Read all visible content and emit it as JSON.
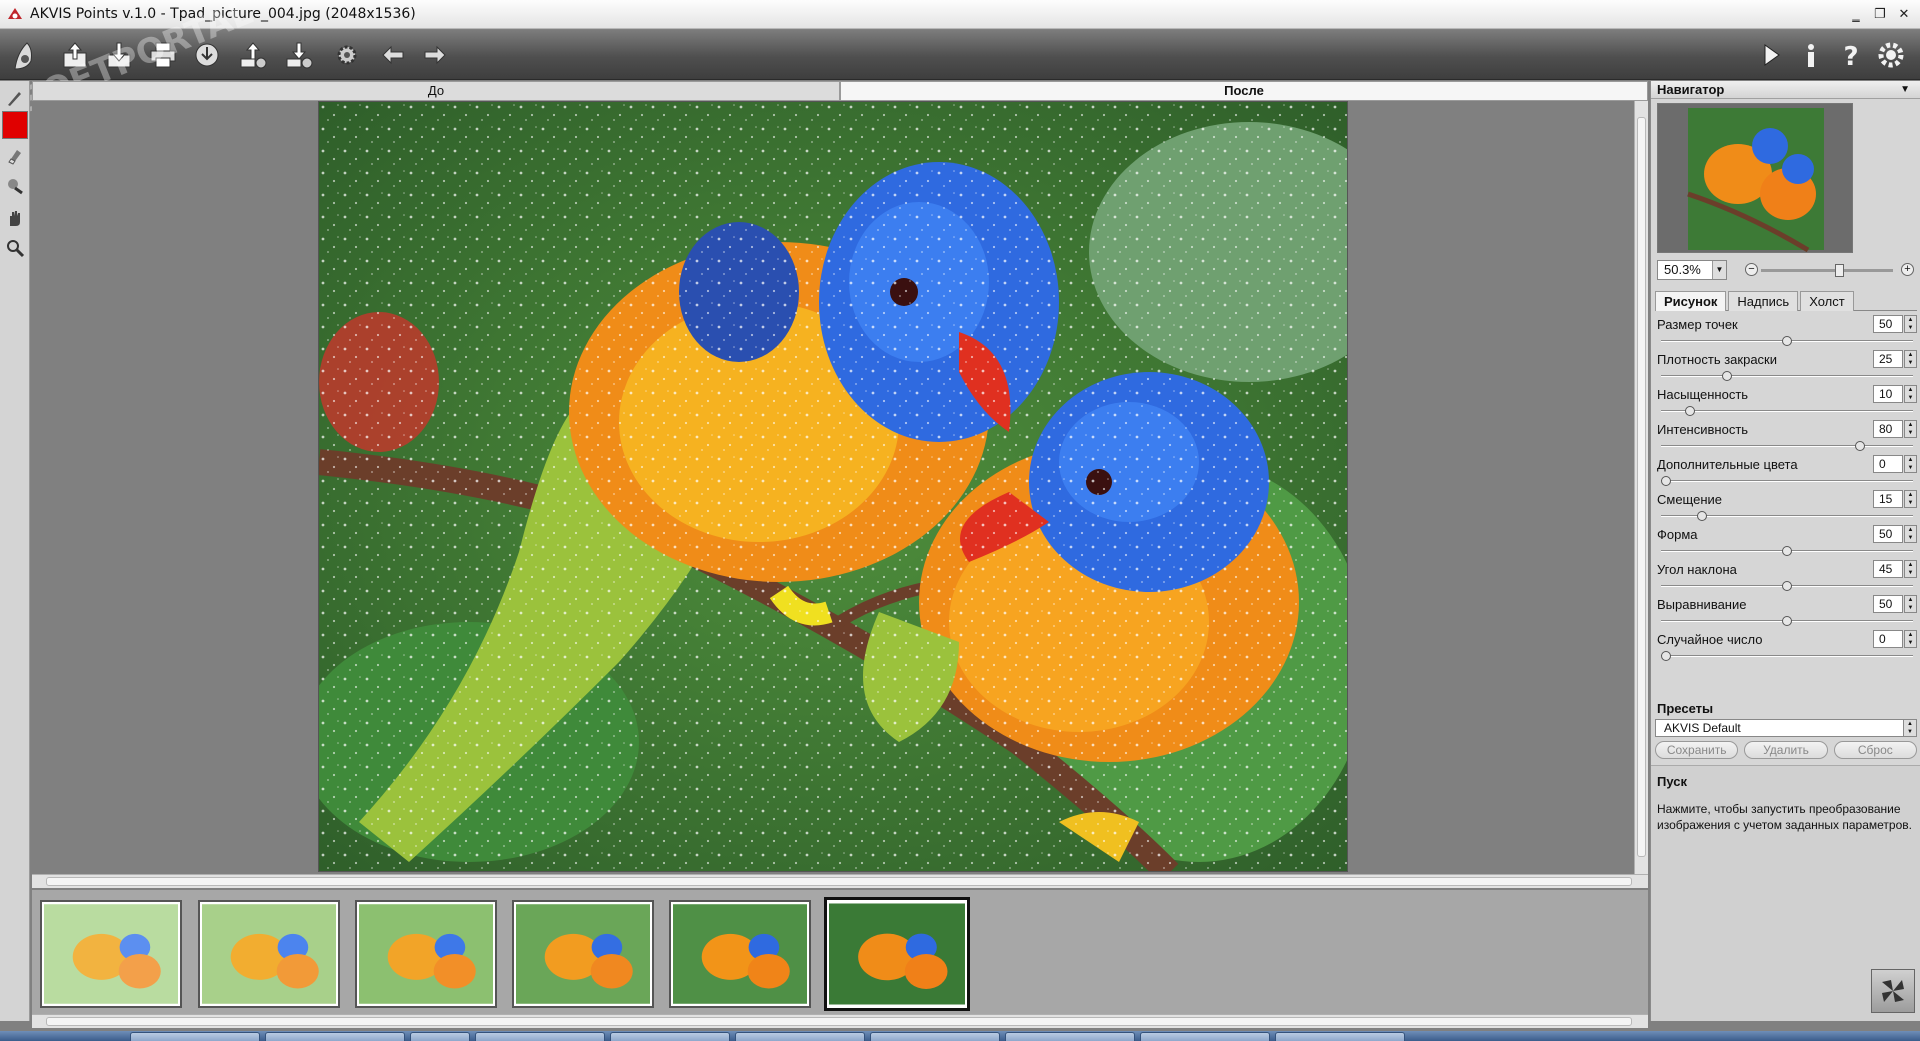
{
  "window": {
    "title": "AKVIS Points v.1.0 - Tpad_picture_004.jpg (2048x1536)",
    "controls": {
      "minimize": "‗",
      "restore": "❐",
      "close": "✕"
    }
  },
  "toolbar": {
    "buttons": [
      {
        "icon": "app-logo-icon"
      },
      {
        "icon": "open-icon"
      },
      {
        "icon": "save-icon"
      },
      {
        "icon": "print-icon"
      },
      {
        "icon": "share-icon"
      },
      {
        "icon": "import-preset-icon"
      },
      {
        "icon": "export-preset-icon"
      },
      {
        "icon": "batch-settings-icon"
      },
      {
        "icon": "undo-icon"
      },
      {
        "icon": "redo-icon"
      },
      {
        "icon": "run-icon"
      },
      {
        "icon": "info-icon"
      },
      {
        "icon": "help-icon"
      },
      {
        "icon": "settings-icon"
      }
    ]
  },
  "tools": [
    {
      "icon": "brush-icon"
    },
    {
      "icon": "color-swatch",
      "color": "#e00000"
    },
    {
      "icon": "eraser-icon"
    },
    {
      "icon": "stamp-icon"
    },
    {
      "icon": "hand-icon"
    },
    {
      "icon": "zoom-icon"
    }
  ],
  "view_tabs": {
    "before": "До",
    "after": "После"
  },
  "navigator": {
    "title": "Навигатор",
    "zoom": "50.3%",
    "zoom_fraction": 0.6
  },
  "param_tabs": {
    "painting": "Рисунок",
    "text": "Надпись",
    "canvas": "Холст"
  },
  "params": [
    {
      "label": "Размер точек",
      "value": "50",
      "max": 100
    },
    {
      "label": "Плотность закраски",
      "value": "25",
      "max": 100
    },
    {
      "label": "Насыщенность",
      "value": "10",
      "max": 100
    },
    {
      "label": "Интенсивность",
      "value": "80",
      "max": 100
    },
    {
      "label": "Дополнительные цвета",
      "value": "0",
      "max": 100
    },
    {
      "label": "Смещение",
      "value": "15",
      "max": 100
    },
    {
      "label": "Форма",
      "value": "50",
      "max": 100
    },
    {
      "label": "Угол наклона",
      "value": "45",
      "max": 90
    },
    {
      "label": "Выравнивание",
      "value": "50",
      "max": 100
    },
    {
      "label": "Случайное число",
      "value": "0",
      "max": 100
    }
  ],
  "presets": {
    "title": "Пресеты",
    "selected": "AKVIS Default",
    "save": "Сохранить",
    "delete": "Удалить",
    "reset": "Сброс"
  },
  "help": {
    "title": "Пуск",
    "text": "Нажмите, чтобы запустить преобразование изображения с учетом заданных параметров."
  },
  "watermark": "SOFTPORTAL",
  "colors": {
    "toolbar": "#4f4f4f",
    "panel": "#d6d6d6",
    "workspace": "#808080",
    "accent_red": "#e00000"
  },
  "thumbnails_selected_index": 5
}
